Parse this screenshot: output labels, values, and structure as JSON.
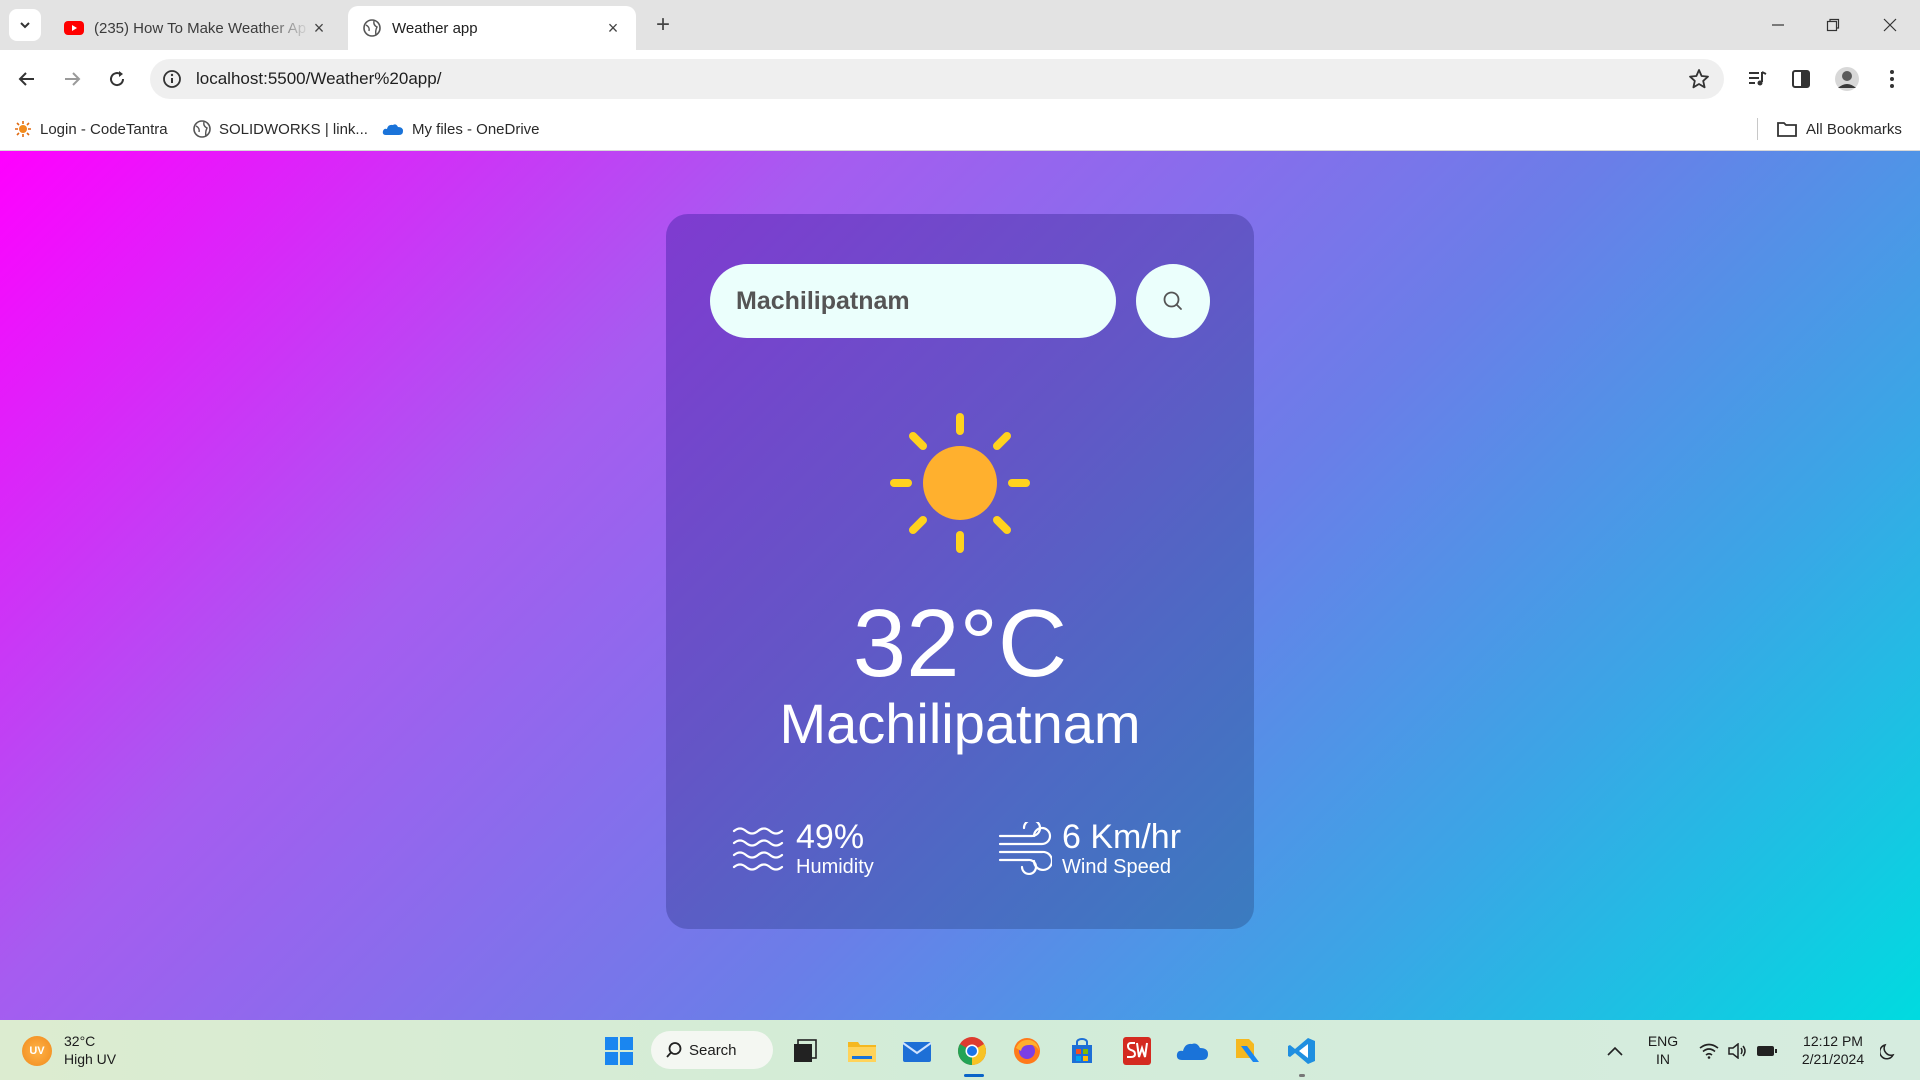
{
  "browser": {
    "tabs": [
      {
        "title": "(235) How To Make Weather Ap",
        "favicon": "youtube-icon",
        "active": false
      },
      {
        "title": "Weather app",
        "favicon": "globe-icon",
        "active": true
      }
    ],
    "url": "localhost:5500/Weather%20app/",
    "bookmarks": [
      {
        "label": "Login - CodeTantra",
        "icon": "codetantra-icon"
      },
      {
        "label": "SOLIDWORKS | link...",
        "icon": "globe-icon"
      },
      {
        "label": "My files - OneDrive",
        "icon": "onedrive-icon"
      }
    ],
    "all_bookmarks_label": "All Bookmarks"
  },
  "weather_app": {
    "search_value": "Machilipatnam",
    "condition_icon": "sun-icon",
    "temperature": "32°C",
    "city": "Machilipatnam",
    "humidity": {
      "value": "49%",
      "label": "Humidity",
      "icon": "humidity-waves-icon"
    },
    "wind": {
      "value": "6 Km/hr",
      "label": "Wind Speed",
      "icon": "wind-icon"
    }
  },
  "taskbar": {
    "weather_temp": "32°C",
    "weather_desc": "High UV",
    "uv_badge": "UV",
    "search_label": "Search",
    "language_line1": "ENG",
    "language_line2": "IN",
    "time": "12:12 PM",
    "date": "2/21/2024",
    "apps": [
      "windows-start-icon",
      "search-icon",
      "task-view-icon",
      "file-explorer-icon",
      "mail-icon",
      "chrome-icon",
      "firefox-icon",
      "microsoft-store-icon",
      "solidworks-icon",
      "onedrive-icon",
      "files-icon",
      "vscode-icon"
    ]
  },
  "colors": {
    "page_gradient": [
      "#ff00ff",
      "#00dbe0"
    ],
    "card": "#6356c6",
    "sun": "#ffb02e",
    "sun_rays": "#ffd21e"
  }
}
